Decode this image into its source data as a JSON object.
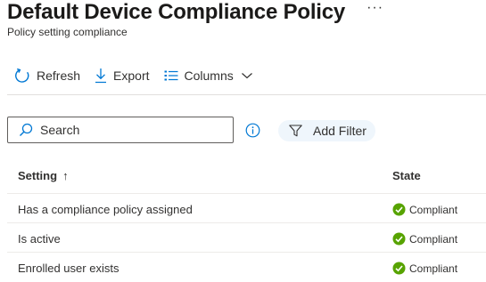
{
  "header": {
    "title": "Default Device Compliance Policy",
    "more": "···",
    "subtitle": "Policy setting compliance"
  },
  "toolbar": {
    "refresh_label": "Refresh",
    "export_label": "Export",
    "columns_label": "Columns"
  },
  "search": {
    "placeholder": "Search",
    "value": ""
  },
  "filter": {
    "label": "Add Filter"
  },
  "table": {
    "columns": {
      "setting": "Setting",
      "sort": "↑",
      "state": "State"
    },
    "rows": [
      {
        "setting": "Has a compliance policy assigned",
        "state": "Compliant"
      },
      {
        "setting": "Is active",
        "state": "Compliant"
      },
      {
        "setting": "Enrolled user exists",
        "state": "Compliant"
      }
    ]
  },
  "colors": {
    "accent": "#0078d4",
    "compliant": "#57a300",
    "filter_bg": "#eff6fc"
  },
  "icons": {
    "refresh": "refresh-icon",
    "export": "download-icon",
    "columns": "columns-list-icon",
    "chevron": "chevron-down-icon",
    "search": "search-icon",
    "info": "info-icon",
    "filter": "filter-icon",
    "status": "check-circle-icon"
  }
}
